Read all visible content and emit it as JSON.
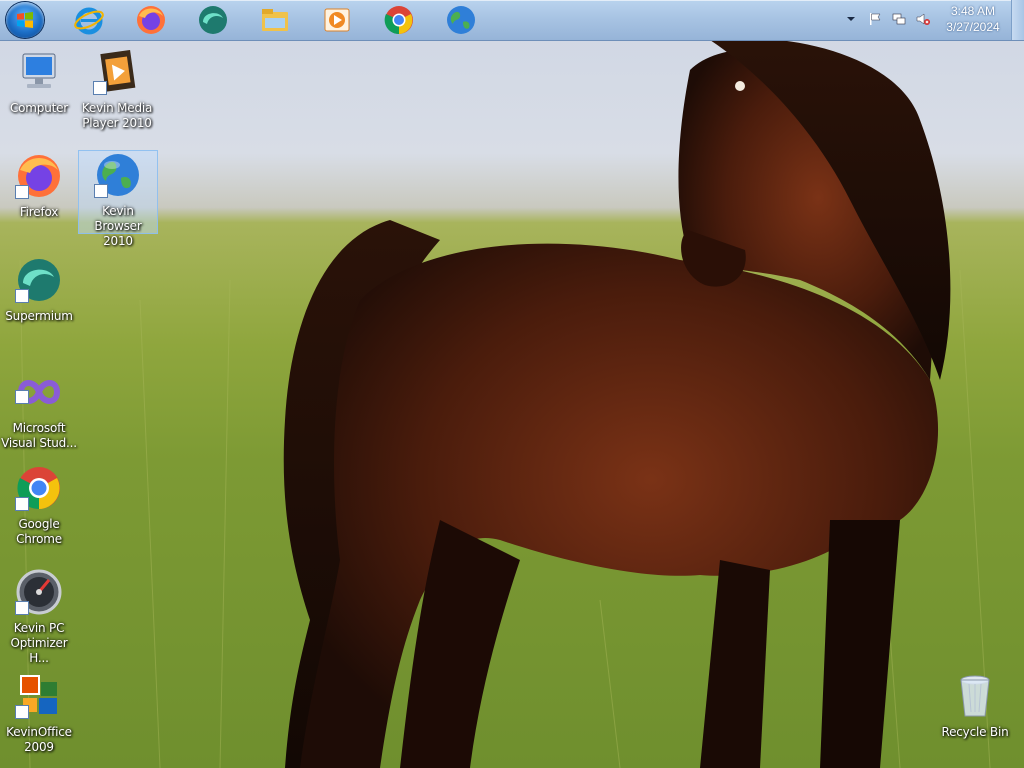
{
  "taskbar": {
    "pinned": [
      {
        "name": "internet-explorer-icon"
      },
      {
        "name": "firefox-icon"
      },
      {
        "name": "supermium-icon"
      },
      {
        "name": "file-explorer-icon"
      },
      {
        "name": "media-player-icon"
      },
      {
        "name": "google-chrome-icon"
      },
      {
        "name": "kevin-browser-icon"
      }
    ],
    "clock": {
      "time": "3:48 AM",
      "date": "3/27/2024"
    }
  },
  "desktop": {
    "icons": [
      {
        "label": "Computer"
      },
      {
        "label": "Kevin Media Player 2010"
      },
      {
        "label": "Firefox"
      },
      {
        "label": "Kevin Browser 2010"
      },
      {
        "label": "Supermium"
      },
      {
        "label": "Microsoft Visual Stud..."
      },
      {
        "label": "Google Chrome"
      },
      {
        "label": "Kevin PC Optimizer H..."
      },
      {
        "label": "KevinOffice 2009"
      },
      {
        "label": "Recycle Bin"
      }
    ]
  },
  "colors": {
    "taskbar": "#a6c2e2",
    "accent": "#1c6fc7",
    "sky": "#d8dde6",
    "grass": "#7d9a34",
    "horse": "#5a2410"
  }
}
